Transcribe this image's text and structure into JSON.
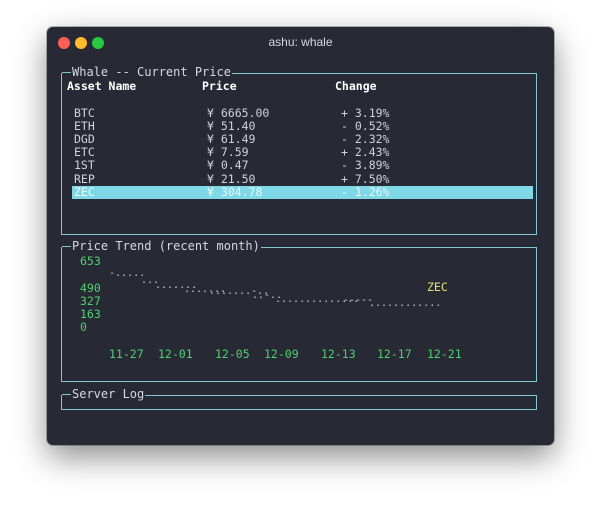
{
  "window": {
    "title": "ashu: whale"
  },
  "price_panel": {
    "title": "Whale -- Current Price",
    "headers": {
      "asset": "Asset Name",
      "price": "Price",
      "change": "Change"
    },
    "rows": [
      {
        "asset": "BTC",
        "price": "¥ 6665.00",
        "change": "+ 3.19%"
      },
      {
        "asset": "ETH",
        "price": "¥ 51.40",
        "change": "- 0.52%"
      },
      {
        "asset": "DGD",
        "price": "¥ 61.49",
        "change": "- 2.32%"
      },
      {
        "asset": "ETC",
        "price": "¥ 7.59",
        "change": "+ 2.43%"
      },
      {
        "asset": "1ST",
        "price": "¥ 0.47",
        "change": "- 3.89%"
      },
      {
        "asset": "REP",
        "price": "¥ 21.50",
        "change": "+ 7.50%"
      },
      {
        "asset": "ZEC",
        "price": "¥ 304.78",
        "change": "- 1.26%",
        "selected": true
      }
    ]
  },
  "trend_panel": {
    "title": "Price Trend (recent month)",
    "y_labels": [
      "653",
      "490",
      "327",
      "163",
      "0"
    ],
    "x_labels": [
      "11-27",
      "12-01",
      "12-05",
      "12-09",
      "12-13",
      "12-17",
      "12-21"
    ],
    "series_name": "ZEC"
  },
  "chart_data": {
    "type": "line",
    "title": "Price Trend (recent month)",
    "x": [
      "11-27",
      "12-01",
      "12-05",
      "12-09",
      "12-13",
      "12-17",
      "12-21"
    ],
    "series": [
      {
        "name": "ZEC",
        "values": [
          600,
          540,
          505,
          470,
          450,
          435,
          420
        ]
      }
    ],
    "ylim": [
      0,
      653
    ],
    "yticks": [
      0,
      163,
      327,
      490,
      653
    ]
  },
  "log_panel": {
    "title": "Server Log"
  }
}
